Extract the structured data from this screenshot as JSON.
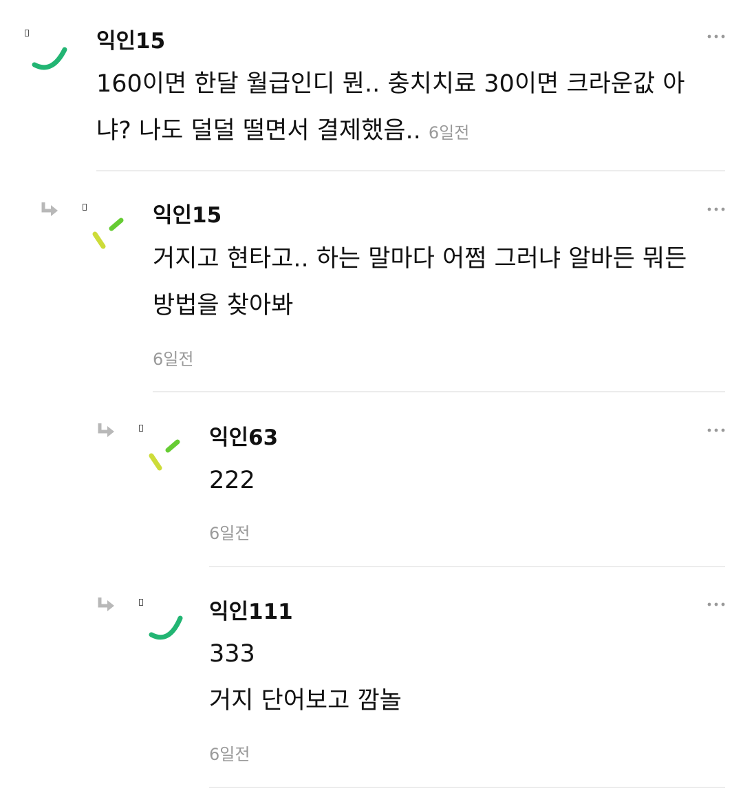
{
  "comments": [
    {
      "nickname": "익인15",
      "lines": [
        "160이면 한달 월급인디 뭔.. 충치치료 30이면 크라운값 아",
        "냐? 나도 덜덜 떨면서 결제했음.."
      ],
      "time": "6일전",
      "avatar": "green-arc"
    },
    {
      "nickname": "익인15",
      "lines": [
        "거지고 현타고.. 하는 말마다 어쩜 그러냐 알바든 뭐든",
        "방법을 찾아봐"
      ],
      "time": "6일전",
      "avatar": "yellow-green-dashes"
    },
    {
      "nickname": "익인63",
      "lines": [
        "222"
      ],
      "time": "6일전",
      "avatar": "yellow-green-dashes"
    },
    {
      "nickname": "익인111",
      "lines": [
        "333",
        "거지 단어보고 깜놀"
      ],
      "time": "6일전",
      "avatar": "green-arc"
    }
  ],
  "colors": {
    "avatar_green": "#22b573",
    "avatar_yellow": "#cddc39",
    "avatar_lime": "#66cc33",
    "timestamp": "#9a9a9a",
    "divider": "#ececec"
  },
  "icons": [
    "reply-arrow-icon",
    "more-options-icon"
  ]
}
